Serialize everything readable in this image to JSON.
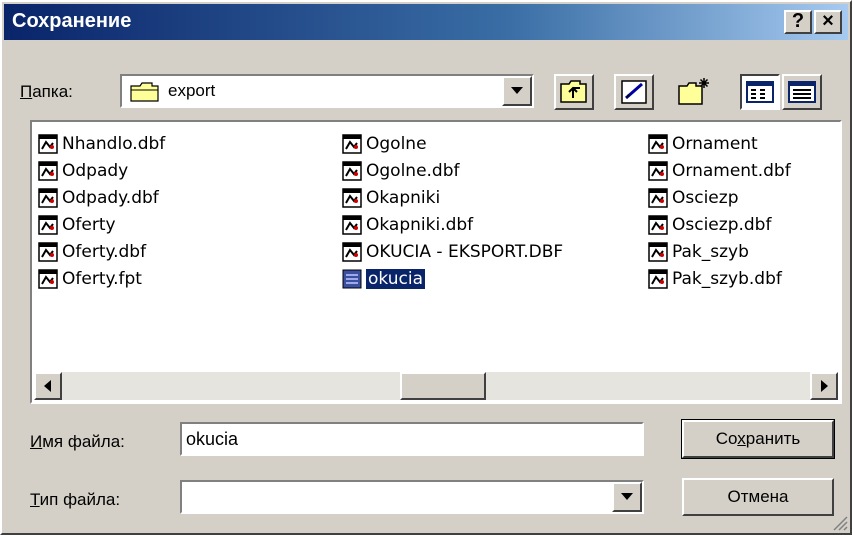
{
  "dialog": {
    "title": "Сохранение",
    "help_button": "?",
    "close_button": "×"
  },
  "folder": {
    "label_prefix": "П",
    "label_rest": "апка:",
    "value": "export"
  },
  "toolbar": {
    "icons": [
      "up-one-level-icon",
      "desktop-icon",
      "new-folder-icon",
      "list-view-icon",
      "details-view-icon"
    ]
  },
  "files": {
    "columns": [
      [
        "Nhandlo.dbf",
        "Odpady",
        "Odpady.dbf",
        "Oferty",
        "Oferty.dbf",
        "Oferty.fpt"
      ],
      [
        "Ogolne",
        "Ogolne.dbf",
        "Okapniki",
        "Okapniki.dbf",
        "OKUCIA - EKSPORT.DBF",
        "okucia"
      ],
      [
        "Ornament",
        "Ornament.dbf",
        "Osciezp",
        "Osciezp.dbf",
        "Pak_szyb",
        "Pak_szyb.dbf"
      ]
    ],
    "selected": "okucia"
  },
  "filename": {
    "label_prefix": "И",
    "label_rest": "мя файла:",
    "value": "okucia"
  },
  "filetype": {
    "label_prefix": "Т",
    "label_rest": "ип файла:",
    "value": ""
  },
  "buttons": {
    "save_pre": "Со",
    "save_ul": "х",
    "save_post": "ранить",
    "cancel": "Отмена"
  },
  "colors": {
    "title_gradient_start": "#0a246a",
    "title_gradient_end": "#a6caf0",
    "face": "#d4d0c8",
    "selection": "#0a246a"
  }
}
